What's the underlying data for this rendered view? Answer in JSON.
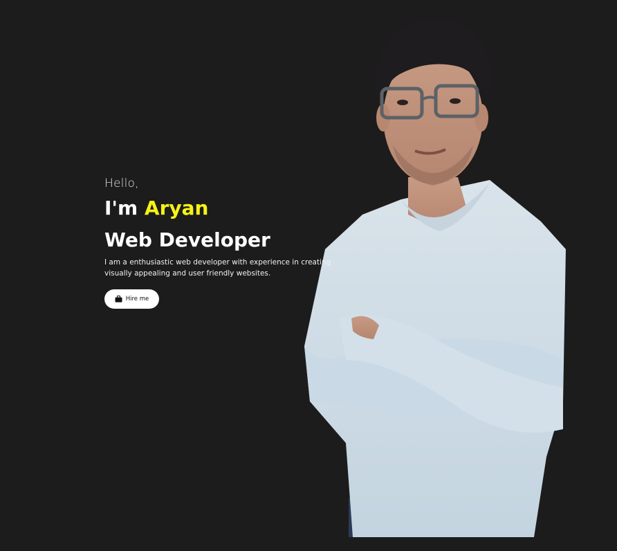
{
  "hero": {
    "greeting": "Hello,",
    "name_prefix": "I'm ",
    "name": "Aryan",
    "role": "Web Developer",
    "bio": "I am a enthusiastic web developer with experience in creating visually appealing and user friendly websites.",
    "hire_button_label": "Hire me",
    "hire_button_icon": "briefcase-icon"
  },
  "colors": {
    "background": "#1c1c1c",
    "accent": "#f7f216",
    "text": "#ffffff",
    "button_bg": "#ffffff"
  }
}
